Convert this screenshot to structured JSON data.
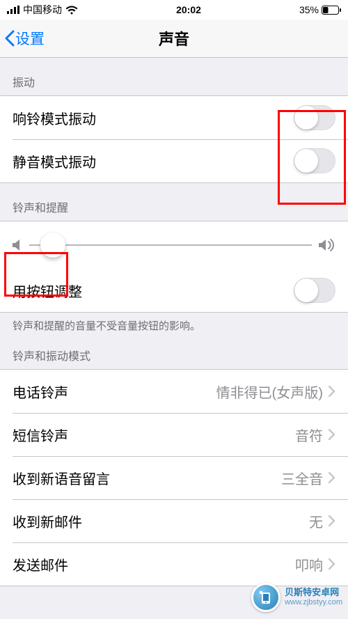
{
  "status": {
    "carrier": "中国移动",
    "time": "20:02",
    "battery": "35%"
  },
  "header": {
    "back_label": "设置",
    "title": "声音"
  },
  "sections": {
    "vibration": {
      "header": "振动",
      "ring_vibrate": "响铃模式振动",
      "silent_vibrate": "静音模式振动"
    },
    "ringer": {
      "header": "铃声和提醒",
      "change_with_buttons": "用按钮调整",
      "footer": "铃声和提醒的音量不受音量按钮的影响。"
    },
    "patterns": {
      "header": "铃声和振动模式",
      "items": [
        {
          "label": "电话铃声",
          "value": "情非得已(女声版)"
        },
        {
          "label": "短信铃声",
          "value": "音符"
        },
        {
          "label": "收到新语音留言",
          "value": "三全音"
        },
        {
          "label": "收到新邮件",
          "value": "无"
        },
        {
          "label": "发送邮件",
          "value": "叩响"
        }
      ]
    }
  },
  "watermark": {
    "name": "贝斯特安卓网",
    "url": "www.zjbstyy.com"
  }
}
